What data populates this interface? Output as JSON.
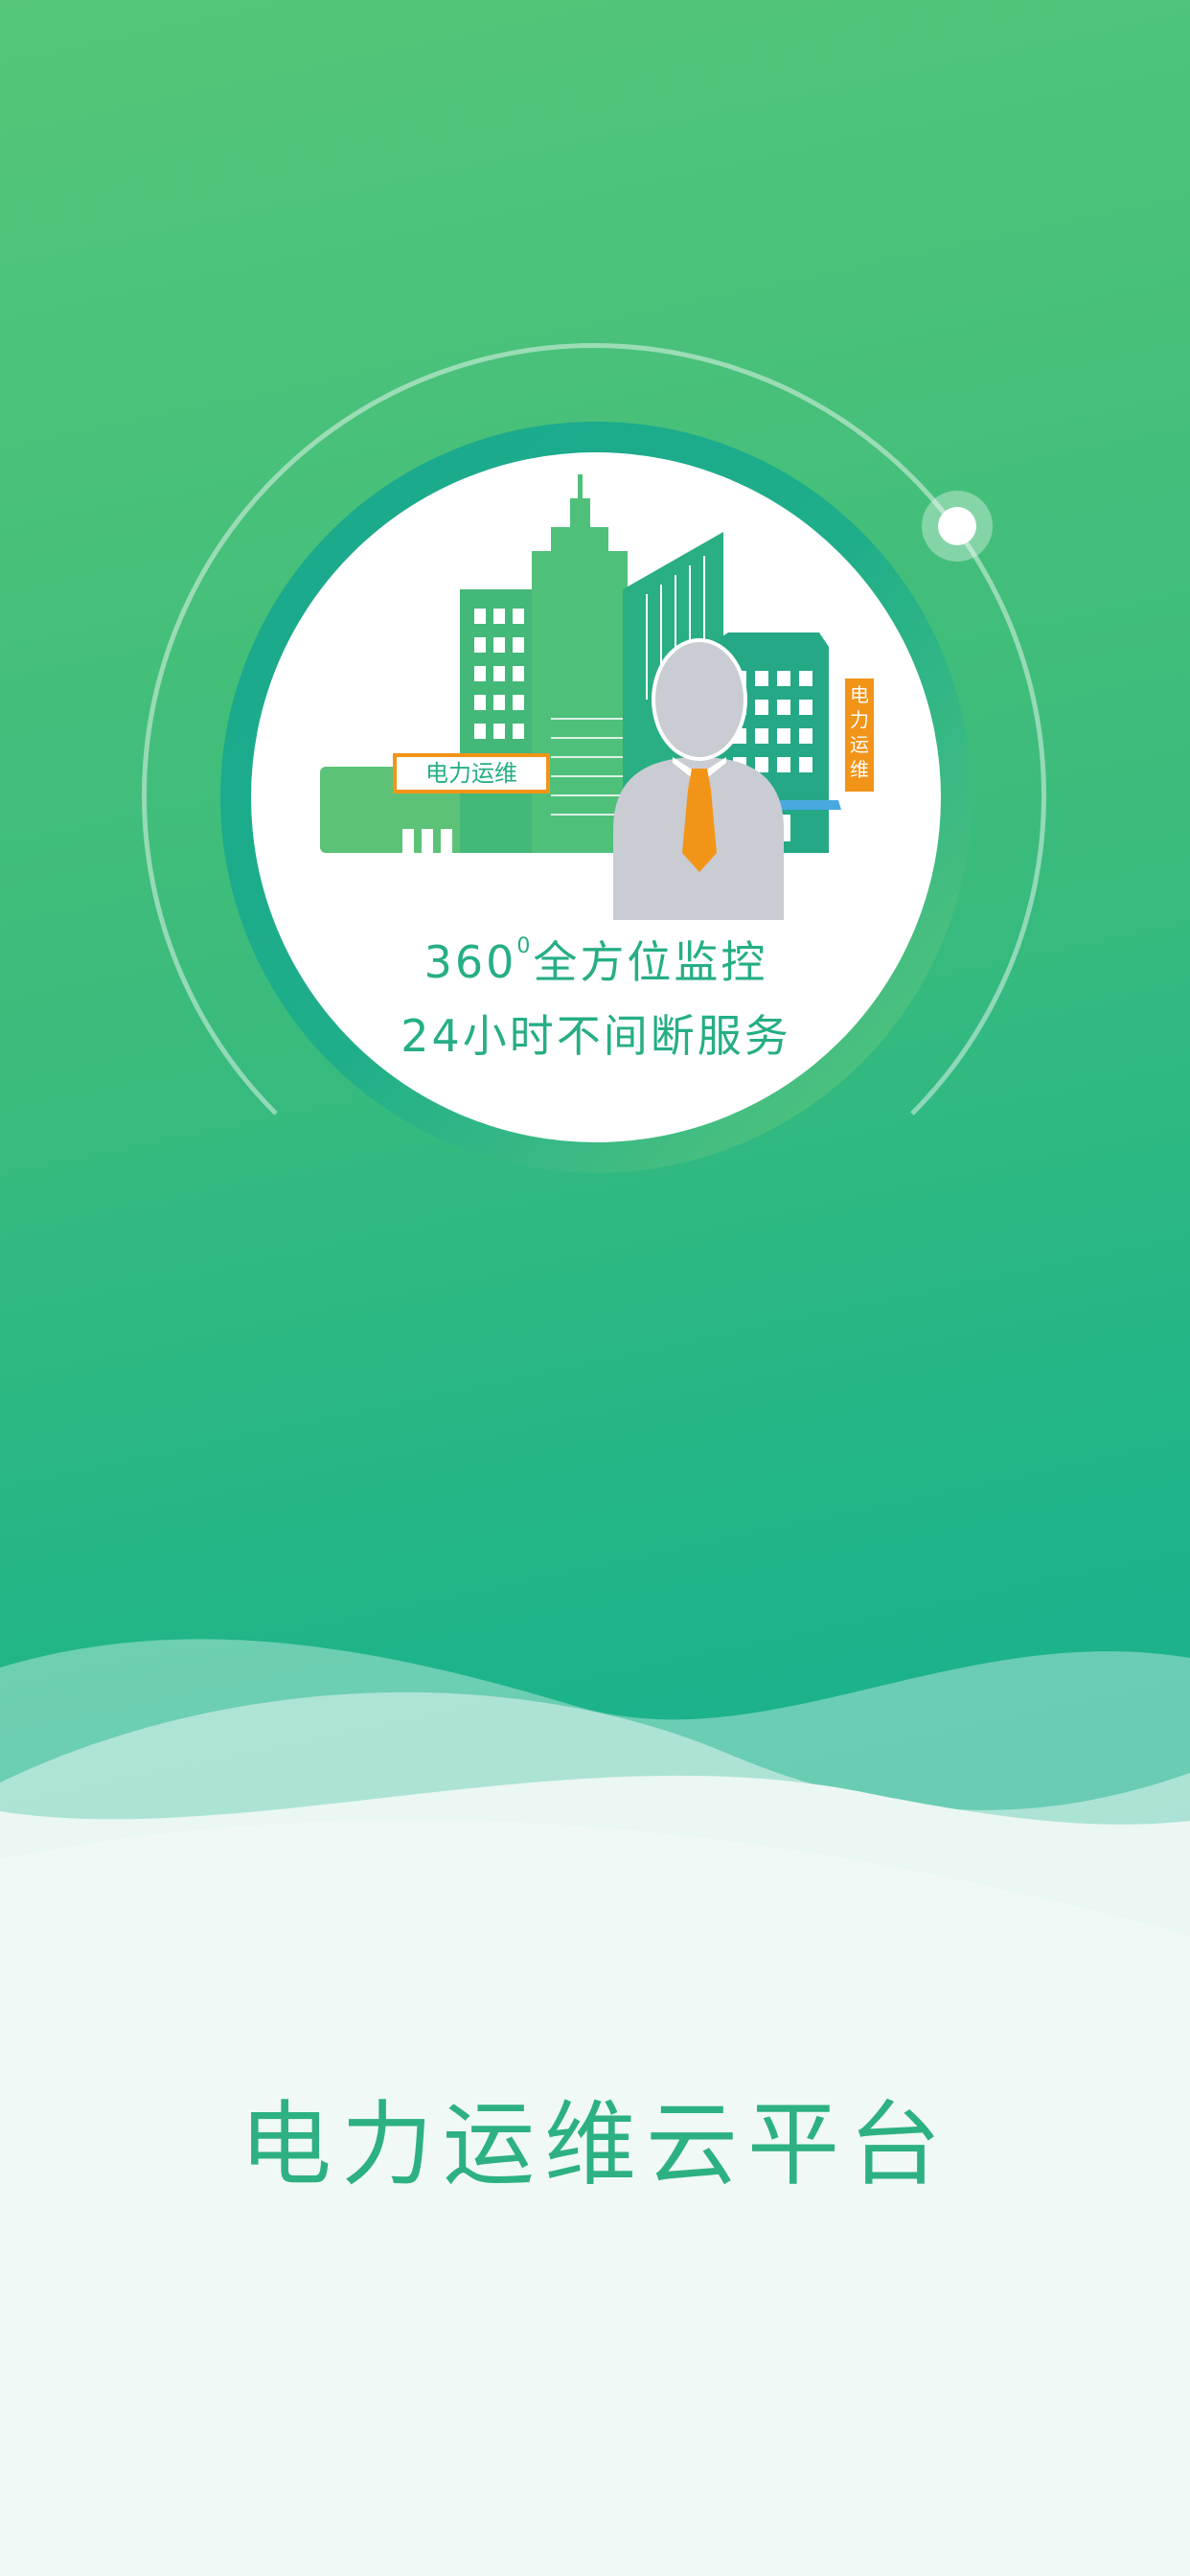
{
  "splash": {
    "slogan_line1_prefix": "360",
    "slogan_line1_sup": "0",
    "slogan_line1_suffix": "全方位监控",
    "slogan_line2": "24小时不间断服务",
    "app_name": "电力运维云平台",
    "sign_horizontal": "电力运维",
    "sign_vertical": [
      "电",
      "力",
      "运",
      "维"
    ]
  },
  "colors": {
    "gradient_top": "#55c679",
    "gradient_bottom": "#19b08b",
    "accent_text": "#2db182",
    "sign_orange": "#f29418"
  }
}
